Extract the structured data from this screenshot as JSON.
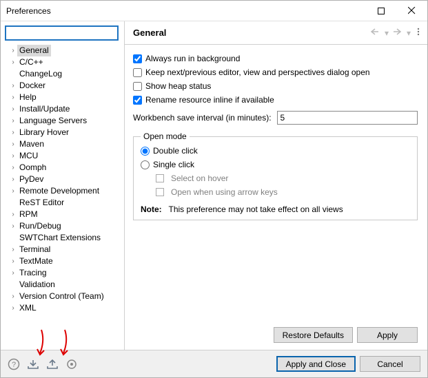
{
  "window": {
    "title": "Preferences"
  },
  "sidebar": {
    "search": "",
    "items": [
      {
        "label": "General",
        "expandable": true,
        "selected": true
      },
      {
        "label": "C/C++",
        "expandable": true
      },
      {
        "label": "ChangeLog",
        "expandable": false
      },
      {
        "label": "Docker",
        "expandable": true
      },
      {
        "label": "Help",
        "expandable": true
      },
      {
        "label": "Install/Update",
        "expandable": true
      },
      {
        "label": "Language Servers",
        "expandable": true
      },
      {
        "label": "Library Hover",
        "expandable": true
      },
      {
        "label": "Maven",
        "expandable": true
      },
      {
        "label": "MCU",
        "expandable": true
      },
      {
        "label": "Oomph",
        "expandable": true
      },
      {
        "label": "PyDev",
        "expandable": true
      },
      {
        "label": "Remote Development",
        "expandable": true
      },
      {
        "label": "ReST Editor",
        "expandable": false
      },
      {
        "label": "RPM",
        "expandable": true
      },
      {
        "label": "Run/Debug",
        "expandable": true
      },
      {
        "label": "SWTChart Extensions",
        "expandable": false
      },
      {
        "label": "Terminal",
        "expandable": true
      },
      {
        "label": "TextMate",
        "expandable": true
      },
      {
        "label": "Tracing",
        "expandable": true
      },
      {
        "label": "Validation",
        "expandable": false
      },
      {
        "label": "Version Control (Team)",
        "expandable": true
      },
      {
        "label": "XML",
        "expandable": true
      }
    ]
  },
  "main": {
    "heading": "General",
    "checks": {
      "run_bg": {
        "label": "Always run in background",
        "checked": true
      },
      "keep_editor": {
        "label": "Keep next/previous editor, view and perspectives dialog open",
        "checked": false
      },
      "heap": {
        "label": "Show heap status",
        "checked": false
      },
      "rename_inline": {
        "label": "Rename resource inline if available",
        "checked": true
      }
    },
    "save_interval": {
      "label": "Workbench save interval (in minutes):",
      "value": "5"
    },
    "open_mode": {
      "legend": "Open mode",
      "double": "Double click",
      "single": "Single click",
      "selected": "double",
      "hover": "Select on hover",
      "arrow": "Open when using arrow keys"
    },
    "note_prefix": "Note:",
    "note_text": "This preference may not take effect on all views"
  },
  "buttons": {
    "restore": "Restore Defaults",
    "apply": "Apply",
    "apply_close": "Apply and Close",
    "cancel": "Cancel"
  }
}
